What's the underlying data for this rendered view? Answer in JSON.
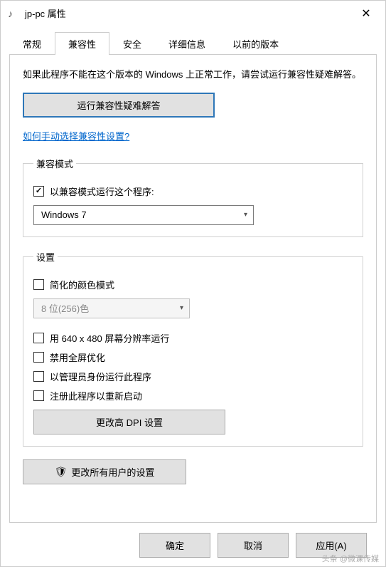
{
  "window": {
    "title": "jp-pc 属性",
    "icon": "♪"
  },
  "tabs": {
    "general": "常规",
    "compat": "兼容性",
    "security": "安全",
    "details": "详细信息",
    "previous": "以前的版本",
    "active": "compat"
  },
  "intro": "如果此程序不能在这个版本的 Windows 上正常工作，请尝试运行兼容性疑难解答。",
  "troubleshoot_btn": "运行兼容性疑难解答",
  "help_link": "如何手动选择兼容性设置?",
  "compat_mode": {
    "legend": "兼容模式",
    "checkbox_label": "以兼容模式运行这个程序:",
    "checked": true,
    "selected": "Windows 7"
  },
  "settings": {
    "legend": "设置",
    "reduced_color": {
      "label": "简化的颜色模式",
      "checked": false
    },
    "color_combo": "8 位(256)色",
    "res640": {
      "label": "用 640 x 480 屏幕分辨率运行",
      "checked": false
    },
    "disable_fullscreen_opt": {
      "label": "禁用全屏优化",
      "checked": false
    },
    "run_admin": {
      "label": "以管理员身份运行此程序",
      "checked": false
    },
    "register_restart": {
      "label": "注册此程序以重新启动",
      "checked": false
    },
    "dpi_btn": "更改高 DPI 设置"
  },
  "all_users_btn": "更改所有用户的设置",
  "buttons": {
    "ok": "确定",
    "cancel": "取消",
    "apply": "应用(A)"
  },
  "watermark": "头条 @微课传媒"
}
